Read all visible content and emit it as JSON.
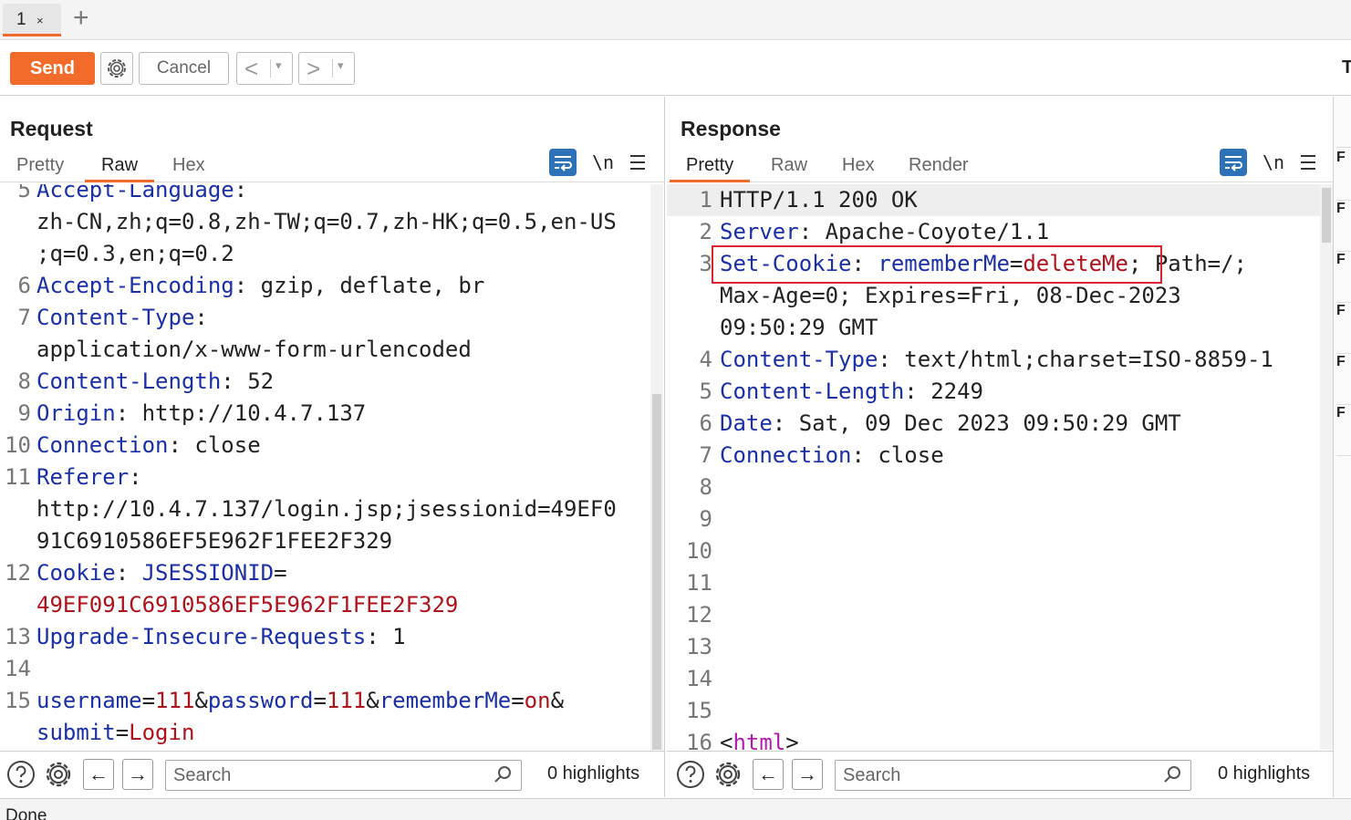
{
  "tabs": {
    "active_label": "1",
    "close_glyph": "×",
    "add_glyph": "+"
  },
  "toolbar": {
    "send_label": "Send",
    "settings_icon": "gear-icon",
    "cancel_label": "Cancel",
    "back_glyph": "<",
    "forward_glyph": ">",
    "dropdown_glyph": "▾",
    "right_cut_label": "T",
    "accent_color": "#f36b2a"
  },
  "request": {
    "title": "Request",
    "subtabs": [
      "Pretty",
      "Raw",
      "Hex"
    ],
    "active_subtab": "Raw",
    "newline_label": "\\n",
    "lines": [
      {
        "n": "5",
        "parts": [
          {
            "t": "Accept-Language",
            "c": "k"
          },
          {
            "t": ":",
            "c": "v"
          }
        ]
      },
      {
        "n": "",
        "parts": [
          {
            "t": "zh-CN,zh;q=0.8,zh-TW;q=0.7,zh-HK;q=0.5,en-US",
            "c": "v"
          }
        ]
      },
      {
        "n": "",
        "parts": [
          {
            "t": ";q=0.3,en;q=0.2",
            "c": "v"
          }
        ]
      },
      {
        "n": "6",
        "parts": [
          {
            "t": "Accept-Encoding",
            "c": "k"
          },
          {
            "t": ": gzip, deflate, br",
            "c": "v"
          }
        ]
      },
      {
        "n": "7",
        "parts": [
          {
            "t": "Content-Type",
            "c": "k"
          },
          {
            "t": ":",
            "c": "v"
          }
        ]
      },
      {
        "n": "",
        "parts": [
          {
            "t": "application/x-www-form-urlencoded",
            "c": "v"
          }
        ]
      },
      {
        "n": "8",
        "parts": [
          {
            "t": "Content-Length",
            "c": "k"
          },
          {
            "t": ": 52",
            "c": "v"
          }
        ]
      },
      {
        "n": "9",
        "parts": [
          {
            "t": "Origin",
            "c": "k"
          },
          {
            "t": ": http://10.4.7.137",
            "c": "v"
          }
        ]
      },
      {
        "n": "10",
        "parts": [
          {
            "t": "Connection",
            "c": "k"
          },
          {
            "t": ": close",
            "c": "v"
          }
        ]
      },
      {
        "n": "11",
        "parts": [
          {
            "t": "Referer",
            "c": "k"
          },
          {
            "t": ":",
            "c": "v"
          }
        ]
      },
      {
        "n": "",
        "parts": [
          {
            "t": "http://10.4.7.137/login.jsp;jsessionid=49EF0",
            "c": "v"
          }
        ]
      },
      {
        "n": "",
        "parts": [
          {
            "t": "91C6910586EF5E962F1FEE2F329",
            "c": "v"
          }
        ]
      },
      {
        "n": "12",
        "parts": [
          {
            "t": "Cookie",
            "c": "k"
          },
          {
            "t": ": ",
            "c": "v"
          },
          {
            "t": "JSESSIONID",
            "c": "k"
          },
          {
            "t": "=",
            "c": "v"
          }
        ]
      },
      {
        "n": "",
        "parts": [
          {
            "t": "49EF091C6910586EF5E962F1FEE2F329",
            "c": "r"
          }
        ]
      },
      {
        "n": "13",
        "parts": [
          {
            "t": "Upgrade-Insecure-Requests",
            "c": "k"
          },
          {
            "t": ": 1",
            "c": "v"
          }
        ]
      },
      {
        "n": "14",
        "parts": []
      },
      {
        "n": "15",
        "parts": [
          {
            "t": "username",
            "c": "k"
          },
          {
            "t": "=",
            "c": "v"
          },
          {
            "t": "111",
            "c": "r"
          },
          {
            "t": "&",
            "c": "v"
          },
          {
            "t": "password",
            "c": "k"
          },
          {
            "t": "=",
            "c": "v"
          },
          {
            "t": "111",
            "c": "r"
          },
          {
            "t": "&",
            "c": "v"
          },
          {
            "t": "rememberMe",
            "c": "k"
          },
          {
            "t": "=",
            "c": "v"
          },
          {
            "t": "on",
            "c": "r"
          },
          {
            "t": "&",
            "c": "v"
          }
        ]
      },
      {
        "n": "",
        "parts": [
          {
            "t": "submit",
            "c": "k"
          },
          {
            "t": "=",
            "c": "v"
          },
          {
            "t": "Login",
            "c": "r"
          }
        ]
      }
    ],
    "search_placeholder": "Search",
    "highlights_label": "0 highlights"
  },
  "response": {
    "title": "Response",
    "subtabs": [
      "Pretty",
      "Raw",
      "Hex",
      "Render"
    ],
    "active_subtab": "Pretty",
    "newline_label": "\\n",
    "lines": [
      {
        "n": "1",
        "parts": [
          {
            "t": "HTTP/1.1 200 OK",
            "c": "v"
          }
        ]
      },
      {
        "n": "2",
        "parts": [
          {
            "t": "Server",
            "c": "k"
          },
          {
            "t": ": Apache-Coyote/1.1",
            "c": "v"
          }
        ]
      },
      {
        "n": "3",
        "parts": [
          {
            "t": "Set-Cookie",
            "c": "k"
          },
          {
            "t": ": ",
            "c": "v"
          },
          {
            "t": "rememberMe",
            "c": "k"
          },
          {
            "t": "=",
            "c": "v"
          },
          {
            "t": "deleteMe",
            "c": "r"
          },
          {
            "t": "; Path=/;",
            "c": "v"
          }
        ]
      },
      {
        "n": "",
        "parts": [
          {
            "t": "Max-Age=0; Expires=Fri, 08-Dec-2023",
            "c": "v"
          }
        ]
      },
      {
        "n": "",
        "parts": [
          {
            "t": "09:50:29 GMT",
            "c": "v"
          }
        ]
      },
      {
        "n": "4",
        "parts": [
          {
            "t": "Content-Type",
            "c": "k"
          },
          {
            "t": ": text/html;charset=ISO-8859-1",
            "c": "v"
          }
        ]
      },
      {
        "n": "5",
        "parts": [
          {
            "t": "Content-Length",
            "c": "k"
          },
          {
            "t": ": 2249",
            "c": "v"
          }
        ]
      },
      {
        "n": "6",
        "parts": [
          {
            "t": "Date",
            "c": "k"
          },
          {
            "t": ": Sat, 09 Dec 2023 09:50:29 GMT",
            "c": "v"
          }
        ]
      },
      {
        "n": "7",
        "parts": [
          {
            "t": "Connection",
            "c": "k"
          },
          {
            "t": ": close",
            "c": "v"
          }
        ]
      },
      {
        "n": "8",
        "parts": []
      },
      {
        "n": "9",
        "parts": []
      },
      {
        "n": "10",
        "parts": []
      },
      {
        "n": "11",
        "parts": []
      },
      {
        "n": "12",
        "parts": []
      },
      {
        "n": "13",
        "parts": []
      },
      {
        "n": "14",
        "parts": []
      },
      {
        "n": "15",
        "parts": []
      },
      {
        "n": "16",
        "parts": [
          {
            "t": "<",
            "c": "v"
          },
          {
            "t": "html",
            "c": "pu"
          },
          {
            "t": ">",
            "c": "v"
          }
        ]
      }
    ],
    "search_placeholder": "Search",
    "highlights_label": "0 highlights"
  },
  "side_strip_label": "F",
  "status_text": "Done"
}
